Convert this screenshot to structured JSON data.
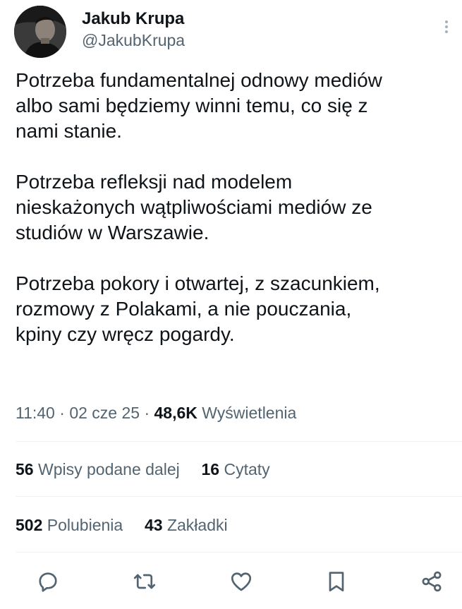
{
  "author": {
    "display_name": "Jakub Krupa",
    "handle": "@JakubKrupa"
  },
  "tweet": {
    "paragraphs": [
      [
        "Potrzeba fundamentalnej odnowy mediów",
        "albo sami będziemy winni temu, co się z",
        "nami stanie."
      ],
      [
        "Potrzeba refleksji nad modelem",
        "nieskażonych wątpliwościami mediów ze",
        "studiów w Warszawie."
      ],
      [
        "Potrzeba pokory i otwartej, z szacunkiem,",
        "rozmowy z Polakami, a nie pouczania,",
        "kpiny czy wręcz pogardy."
      ]
    ],
    "time": "11:40",
    "date": "02 cze 25",
    "separator": "·",
    "views_count": "48,6K",
    "views_label": "Wyświetlenia"
  },
  "stats": {
    "reposts_count": "56",
    "reposts_label": "Wpisy podane dalej",
    "quotes_count": "16",
    "quotes_label": "Cytaty",
    "likes_count": "502",
    "likes_label": "Polubienia",
    "bookmarks_count": "43",
    "bookmarks_label": "Zakładki"
  },
  "icons": {
    "reply": "reply-icon",
    "repost": "repost-icon",
    "like": "like-icon",
    "bookmark": "bookmark-icon",
    "share": "share-icon",
    "more": "more-vertical-icon"
  },
  "colors": {
    "text": "#0f1419",
    "secondary": "#536471",
    "divider": "#eff3f4"
  }
}
